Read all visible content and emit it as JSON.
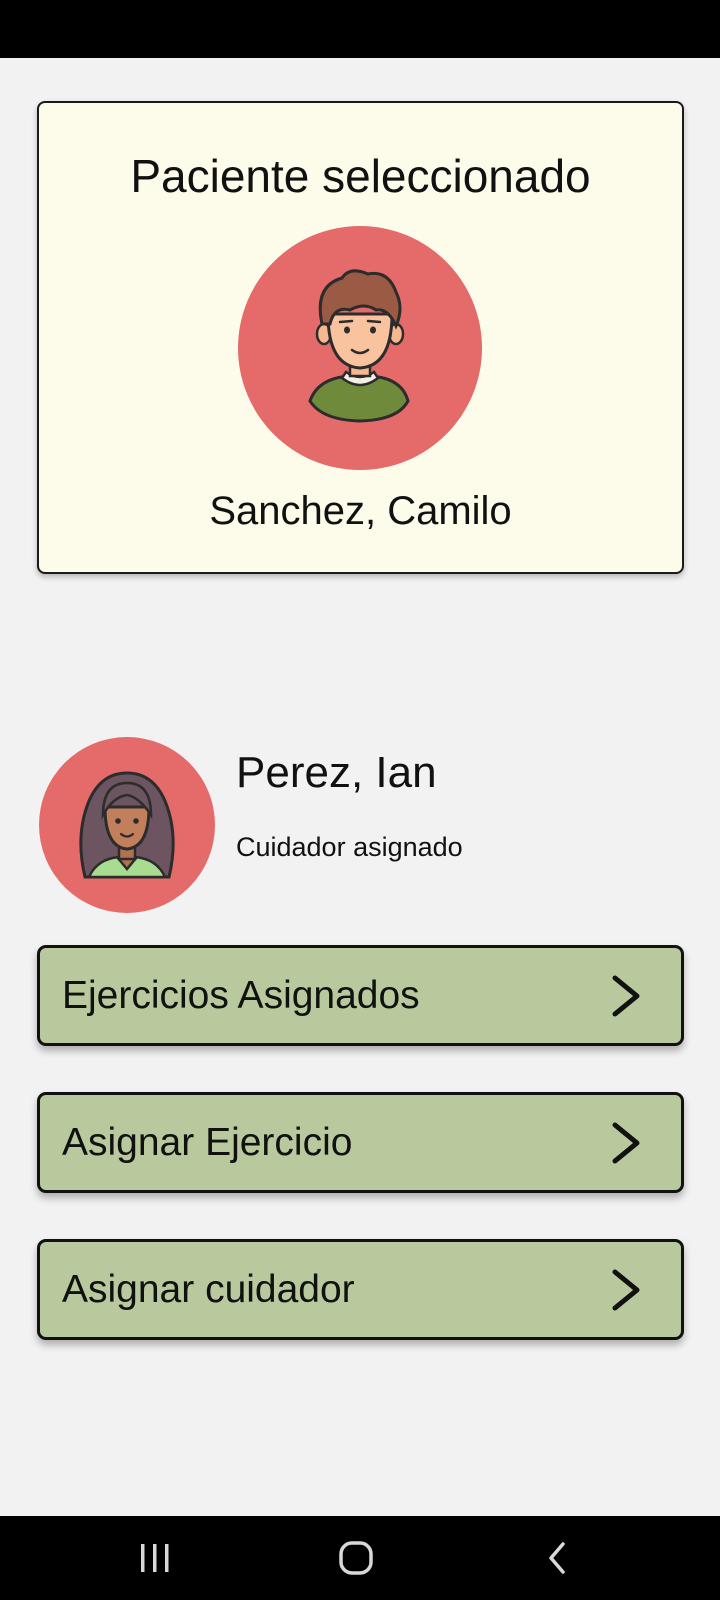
{
  "patient_card": {
    "title": "Paciente seleccionado",
    "avatar_icon": "boy-avatar-icon",
    "name": "Sanchez, Camilo"
  },
  "caregiver": {
    "avatar_icon": "woman-avatar-icon",
    "name": "Perez, Ian",
    "role": "Cuidador asignado"
  },
  "actions": [
    {
      "label": "Ejercicios Asignados",
      "icon": "chevron-right-icon"
    },
    {
      "label": "Asignar Ejercicio",
      "icon": "chevron-right-icon"
    },
    {
      "label": "Asignar cuidador",
      "icon": "chevron-right-icon"
    }
  ],
  "navigation": {
    "recents_icon": "recents-icon",
    "home_icon": "home-icon",
    "back_icon": "back-icon"
  },
  "colors": {
    "background": "#f2f2f2",
    "card_background": "#fdfbea",
    "avatar_background": "#e46b6a",
    "button_background": "#b8c99d"
  }
}
